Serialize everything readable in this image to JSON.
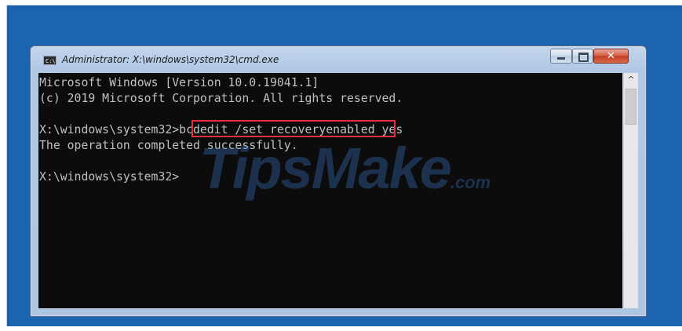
{
  "window": {
    "title": "Administrator: X:\\windows\\system32\\cmd.exe",
    "icon": "cmd-icon",
    "controls": {
      "minimize_icon": "minimize-icon",
      "maximize_icon": "maximize-icon",
      "close_icon": "close-icon",
      "close_glyph": "✕"
    }
  },
  "console": {
    "lines": [
      "Microsoft Windows [Version 10.0.19041.1]",
      "(c) 2019 Microsoft Corporation. All rights reserved.",
      "",
      "X:\\windows\\system32>bcdedit /set recoveryenabled yes",
      "The operation completed successfully.",
      "",
      "X:\\windows\\system32>"
    ],
    "highlighted_command": "bcdedit /set recoveryenabled yes",
    "highlight_color": "#e0323c"
  },
  "scrollbar": {
    "up_arrow": "^"
  },
  "watermark": {
    "text": "TipsMake",
    "suffix": ".com"
  },
  "colors": {
    "desktop": "#175fa8",
    "console_bg": "#0c0c0c",
    "console_text": "#c0c0c0"
  }
}
